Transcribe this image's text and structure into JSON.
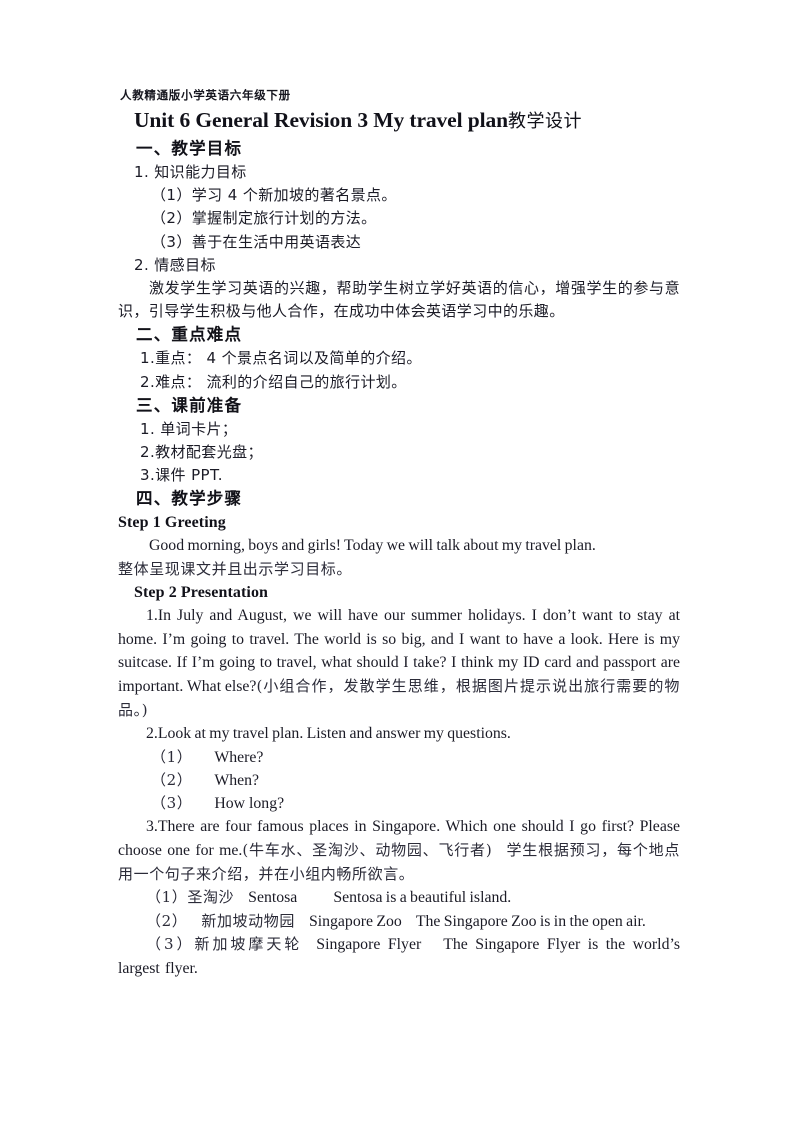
{
  "document": {
    "kicker": "人教精通版小学英语六年级下册",
    "title_en": "Unit 6 General Revision 3 My travel plan",
    "title_cn": "教学设计"
  },
  "sections": {
    "objectives": {
      "heading": "一、教学目标",
      "item1_label": "1.  知识能力目标",
      "item1_sub": [
        "（1）学习 4 个新加坡的著名景点。",
        "（2）掌握制定旅行计划的方法。",
        "（3）善于在生活中用英语表达"
      ],
      "item2_label": "2.  情感目标",
      "item2_body": "激发学生学习英语的兴趣，帮助学生树立学好英语的信心，增强学生的参与意识，引导学生积极与他人合作，在成功中体会英语学习中的乐趣。"
    },
    "keypoints": {
      "heading": "二、重点难点",
      "items": [
        "1.重点：  4 个景点名词以及简单的介绍。",
        "2.难点：  流利的介绍自己的旅行计划。"
      ]
    },
    "preparation": {
      "heading": "三、课前准备",
      "items": [
        "1.  单词卡片；",
        "2.教材配套光盘；",
        "3.课件 PPT."
      ]
    },
    "procedure": {
      "heading": "四、教学步骤",
      "step1": {
        "head": "Step 1 Greeting",
        "body_en": "Good morning, boys and girls! Today we will talk about my travel plan.",
        "body_cn": "整体呈现课文并且出示学习目标。"
      },
      "step2": {
        "head": "Step 2 Presentation",
        "item1_en": "1.In July and August, we will have our summer holidays. I don’t want to stay at home. I’m going to travel. The world is so big, and I want to have a look. Here is my suitcase. If I’m going to travel, what should I take? I think my ID card and passport are important. What else?",
        "item1_cn": "(小组合作，发散学生思维，根据图片提示说出旅行需要的物品。)",
        "item2_en": "2.Look at my travel plan. Listen and answer my questions.",
        "item2_sub": [
          {
            "num": "（1）",
            "text": "Where?"
          },
          {
            "num": "（2）",
            "text": "When?"
          },
          {
            "num": "（3）",
            "text": "How long?"
          }
        ],
        "item3_en": "3.There are four famous places in Singapore. Which one should I go first? Please choose one for me.",
        "item3_cn_paren": "(牛车水、圣淘沙、动物园、飞行者)",
        "item3_cn_tail": "学生根据预习，每个地点用一个句子来介绍，并在小组内畅所欲言。",
        "places": [
          {
            "num": "（1）",
            "name_cn": "圣淘沙",
            "name_en": "Sentosa",
            "sentence": "Sentosa is a beautiful island."
          },
          {
            "num": "（2）",
            "name_cn": "新加坡动物园",
            "name_en": "Singapore Zoo",
            "sentence": "The Singapore Zoo is in the open air."
          },
          {
            "num": "（3）",
            "name_cn": "新加坡摩天轮",
            "name_en": "Singapore Flyer",
            "sentence": "The Singapore Flyer is the world’s largest flyer."
          }
        ]
      }
    }
  },
  "colors": {
    "page_background": "#ffffff",
    "text": "#1b1b26",
    "heading": "#111119"
  }
}
